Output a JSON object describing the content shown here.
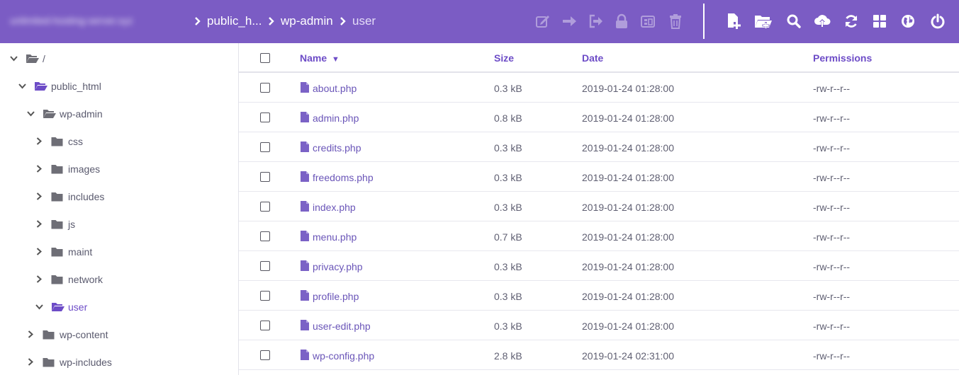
{
  "topbar": {
    "host": "unlimited-hosting-server.xyz",
    "breadcrumbs": [
      "public_h...",
      "wp-admin",
      "user"
    ],
    "actions_disabled": [
      {
        "name": "edit-icon",
        "title": "Edit"
      },
      {
        "name": "move-icon",
        "title": "Move"
      },
      {
        "name": "copy-icon",
        "title": "Copy"
      },
      {
        "name": "lock-icon",
        "title": "Permissions"
      },
      {
        "name": "archive-icon",
        "title": "Archive"
      },
      {
        "name": "trash-icon",
        "title": "Delete"
      }
    ],
    "actions": [
      {
        "name": "new-file-icon",
        "title": "New file"
      },
      {
        "name": "new-folder-icon",
        "title": "New folder"
      },
      {
        "name": "search-icon",
        "title": "Search"
      },
      {
        "name": "upload-icon",
        "title": "Upload"
      },
      {
        "name": "refresh-icon",
        "title": "Refresh"
      },
      {
        "name": "grid-view-icon",
        "title": "View"
      },
      {
        "name": "globe-icon",
        "title": "Language"
      },
      {
        "name": "power-icon",
        "title": "Log out"
      }
    ],
    "accent_color": "#7b5cc4"
  },
  "sidebar": {
    "items": [
      {
        "label": "/",
        "expanded": true,
        "active": false
      },
      {
        "label": "public_html",
        "expanded": true,
        "active": false
      },
      {
        "label": "wp-admin",
        "expanded": true,
        "active": false
      },
      {
        "label": "css",
        "expanded": false,
        "active": false
      },
      {
        "label": "images",
        "expanded": false,
        "active": false
      },
      {
        "label": "includes",
        "expanded": false,
        "active": false
      },
      {
        "label": "js",
        "expanded": false,
        "active": false
      },
      {
        "label": "maint",
        "expanded": false,
        "active": false
      },
      {
        "label": "network",
        "expanded": false,
        "active": false
      },
      {
        "label": "user",
        "expanded": true,
        "active": true
      },
      {
        "label": "wp-content",
        "expanded": false,
        "active": false
      },
      {
        "label": "wp-includes",
        "expanded": false,
        "active": false
      }
    ]
  },
  "table": {
    "columns": {
      "name": "Name",
      "sort_indicator": "▼",
      "size": "Size",
      "date": "Date",
      "permissions": "Permissions"
    },
    "rows": [
      {
        "name": "about.php",
        "size": "0.3 kB",
        "date": "2019-01-24 01:28:00",
        "permissions": "-rw-r--r--"
      },
      {
        "name": "admin.php",
        "size": "0.8 kB",
        "date": "2019-01-24 01:28:00",
        "permissions": "-rw-r--r--"
      },
      {
        "name": "credits.php",
        "size": "0.3 kB",
        "date": "2019-01-24 01:28:00",
        "permissions": "-rw-r--r--"
      },
      {
        "name": "freedoms.php",
        "size": "0.3 kB",
        "date": "2019-01-24 01:28:00",
        "permissions": "-rw-r--r--"
      },
      {
        "name": "index.php",
        "size": "0.3 kB",
        "date": "2019-01-24 01:28:00",
        "permissions": "-rw-r--r--"
      },
      {
        "name": "menu.php",
        "size": "0.7 kB",
        "date": "2019-01-24 01:28:00",
        "permissions": "-rw-r--r--"
      },
      {
        "name": "privacy.php",
        "size": "0.3 kB",
        "date": "2019-01-24 01:28:00",
        "permissions": "-rw-r--r--"
      },
      {
        "name": "profile.php",
        "size": "0.3 kB",
        "date": "2019-01-24 01:28:00",
        "permissions": "-rw-r--r--"
      },
      {
        "name": "user-edit.php",
        "size": "0.3 kB",
        "date": "2019-01-24 01:28:00",
        "permissions": "-rw-r--r--"
      },
      {
        "name": "wp-config.php",
        "size": "2.8 kB",
        "date": "2019-01-24 02:31:00",
        "permissions": "-rw-r--r--"
      }
    ]
  }
}
